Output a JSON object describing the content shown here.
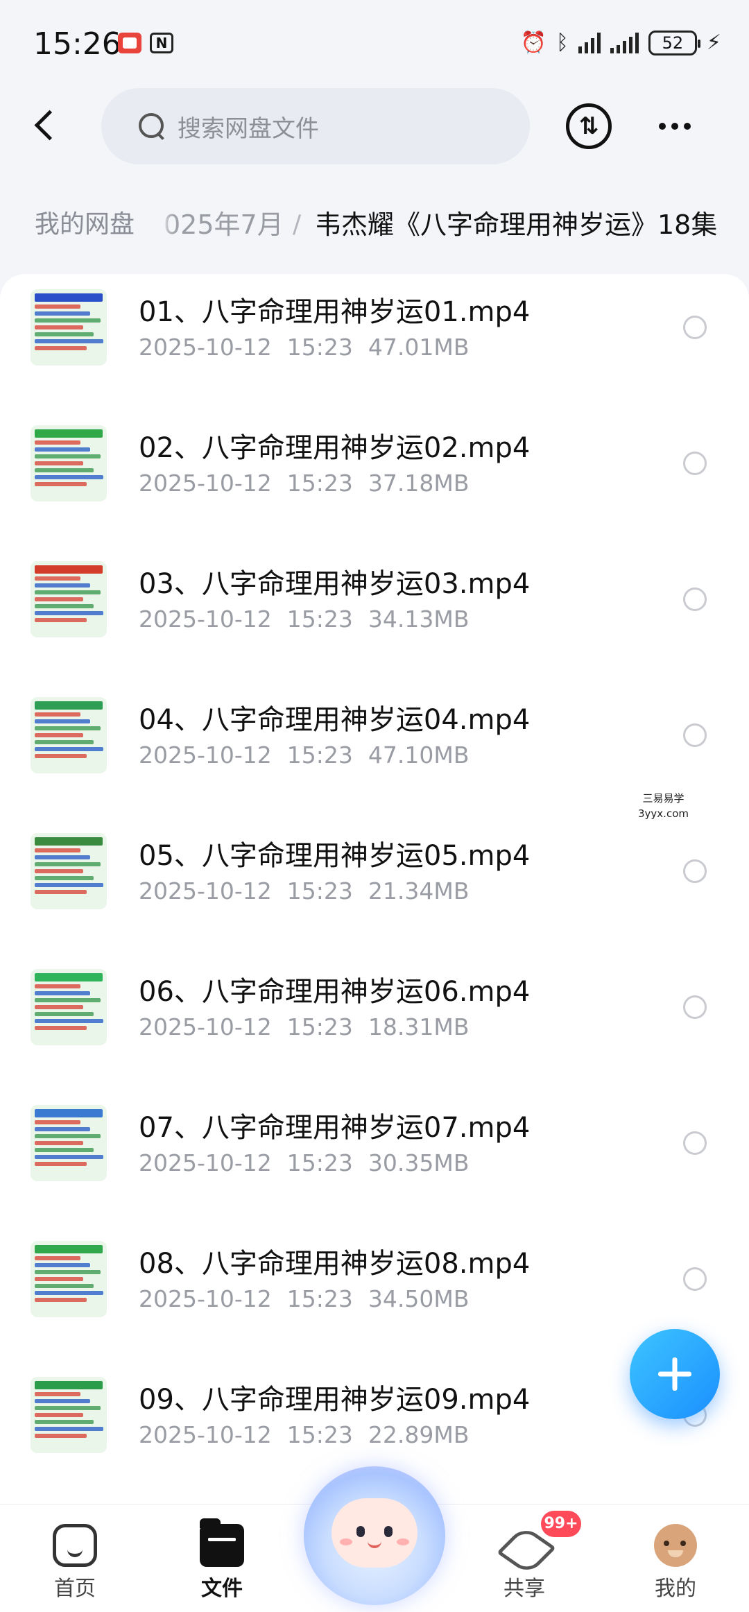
{
  "status_bar": {
    "time": "15:26",
    "battery": "52",
    "icons": [
      "alarm-icon",
      "bluetooth-icon",
      "signal-icon",
      "signal-icon",
      "charging-icon"
    ]
  },
  "header": {
    "search_placeholder": "搜索网盘文件",
    "transfer_icon": "transfer-icon",
    "more_icon": "more-icon"
  },
  "breadcrumb": {
    "root": "我的网盘",
    "middle": "025年7月",
    "separator": "/",
    "current": "韦杰耀《八字命理用神岁运》18集"
  },
  "files": [
    {
      "name": "01、八字命理用神岁运01.mp4",
      "date": "2025-10-12",
      "time": "15:23",
      "size": "47.01MB",
      "thumb_color": "#2b4fc9"
    },
    {
      "name": "02、八字命理用神岁运02.mp4",
      "date": "2025-10-12",
      "time": "15:23",
      "size": "37.18MB",
      "thumb_color": "#2fa84a"
    },
    {
      "name": "03、八字命理用神岁运03.mp4",
      "date": "2025-10-12",
      "time": "15:23",
      "size": "34.13MB",
      "thumb_color": "#d33b2a"
    },
    {
      "name": "04、八字命理用神岁运04.mp4",
      "date": "2025-10-12",
      "time": "15:23",
      "size": "47.10MB",
      "thumb_color": "#2f9e55"
    },
    {
      "name": "05、八字命理用神岁运05.mp4",
      "date": "2025-10-12",
      "time": "15:23",
      "size": "21.34MB",
      "thumb_color": "#3a8a3f"
    },
    {
      "name": "06、八字命理用神岁运06.mp4",
      "date": "2025-10-12",
      "time": "15:23",
      "size": "18.31MB",
      "thumb_color": "#2fb35b"
    },
    {
      "name": "07、八字命理用神岁运07.mp4",
      "date": "2025-10-12",
      "time": "15:23",
      "size": "30.35MB",
      "thumb_color": "#3a7bd1"
    },
    {
      "name": "08、八字命理用神岁运08.mp4",
      "date": "2025-10-12",
      "time": "15:23",
      "size": "34.50MB",
      "thumb_color": "#31a84e"
    },
    {
      "name": "09、八字命理用神岁运09.mp4",
      "date": "2025-10-12",
      "time": "15:23",
      "size": "22.89MB",
      "thumb_color": "#2b9c4a"
    }
  ],
  "watermark": {
    "line1": "三易易学",
    "line2": "3yyx.com"
  },
  "fab_icon": "plus-icon",
  "bottom_nav": {
    "items": [
      {
        "label": "首页",
        "icon": "home-icon"
      },
      {
        "label": "文件",
        "icon": "folder-icon"
      },
      {
        "label": "共享",
        "icon": "share-icon"
      },
      {
        "label": "我的",
        "icon": "avatar-icon"
      }
    ],
    "share_badge": "99+",
    "active": "文件"
  }
}
